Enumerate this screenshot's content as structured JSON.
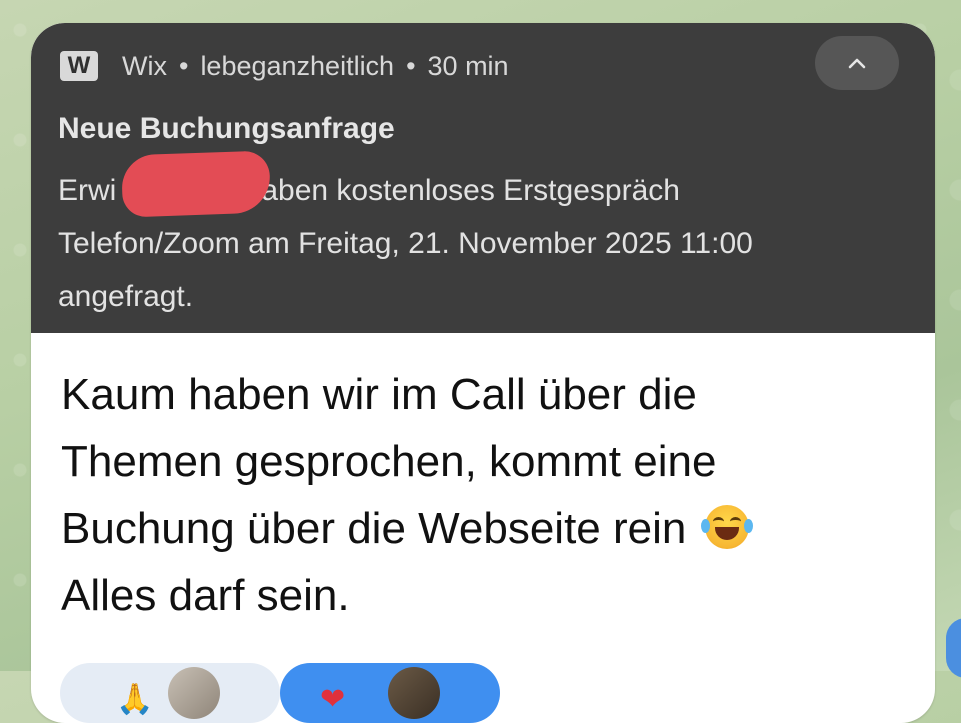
{
  "notification": {
    "app_icon_letter": "W",
    "app_name": "Wix",
    "separator": "•",
    "site": "lebeganzheitlich",
    "time": "30 min",
    "title": "Neue Buchungsanfrage",
    "body_line1_start": "Erwi",
    "body_line1_end": "r haben kostenloses Erstgespräch",
    "body_line2": "Telefon/Zoom am Freitag, 21. November 2025 11:00",
    "body_line3": "angefragt."
  },
  "message": {
    "line1": "Kaum haben wir im Call über die",
    "line2": "Themen gesprochen, kommt eine",
    "line3": "Buchung über die Webseite rein",
    "line4": "Alles darf sein.",
    "emoji_icon": "face-with-tears-of-joy-icon"
  },
  "reactions": {
    "first_emoji": "🙏",
    "second_emoji": "❤"
  },
  "colors": {
    "notification_bg": "#3d3d3d",
    "redaction": "#e34c55",
    "reaction_active": "#3f8ff0"
  }
}
